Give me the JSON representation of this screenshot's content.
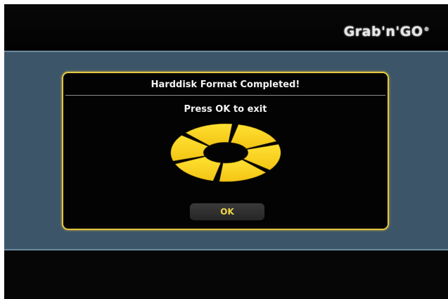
{
  "header": {
    "brand": "Grab'n'GO",
    "brand_mark": "®"
  },
  "dialog": {
    "title": "Harddisk Format Completed!",
    "message": "Press OK to exit",
    "ok_label": "OK",
    "spinner_icon": "busy-spinner-icon"
  },
  "colors": {
    "accent": "#e3c643",
    "band": "#3d5569",
    "background": "#050505"
  }
}
